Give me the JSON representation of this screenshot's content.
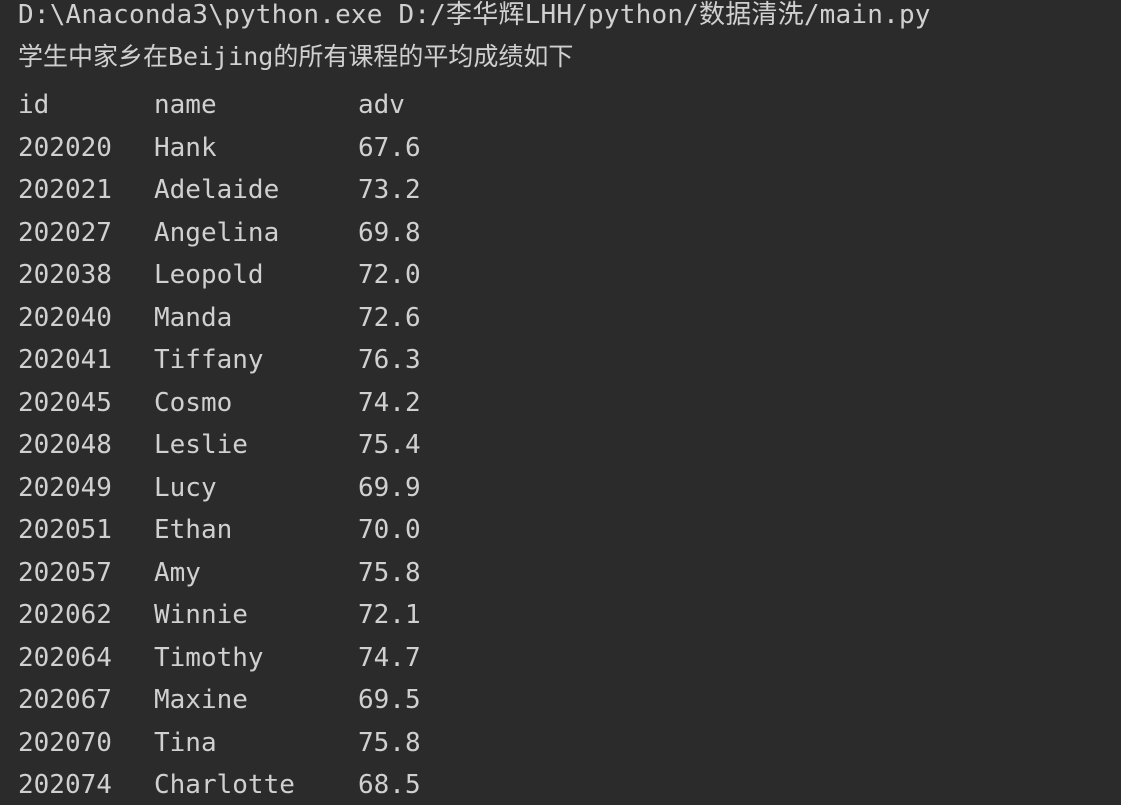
{
  "console": {
    "command": "D:\\Anaconda3\\python.exe D:/李华辉LHH/python/数据清洗/main.py",
    "caption": "学生中家乡在Beijing的所有课程的平均成绩如下",
    "headers": [
      "id",
      "name",
      "adv"
    ],
    "rows": [
      [
        "202020",
        "Hank",
        "67.6"
      ],
      [
        "202021",
        "Adelaide",
        "73.2"
      ],
      [
        "202027",
        "Angelina",
        "69.8"
      ],
      [
        "202038",
        "Leopold",
        "72.0"
      ],
      [
        "202040",
        "Manda",
        "72.6"
      ],
      [
        "202041",
        "Tiffany",
        "76.3"
      ],
      [
        "202045",
        "Cosmo",
        "74.2"
      ],
      [
        "202048",
        "Leslie",
        "75.4"
      ],
      [
        "202049",
        "Lucy",
        "69.9"
      ],
      [
        "202051",
        "Ethan",
        "70.0"
      ],
      [
        "202057",
        "Amy",
        "75.8"
      ],
      [
        "202062",
        "Winnie",
        "72.1"
      ],
      [
        "202064",
        "Timothy",
        "74.7"
      ],
      [
        "202067",
        "Maxine",
        "69.5"
      ],
      [
        "202070",
        "Tina",
        "75.8"
      ],
      [
        "202074",
        "Charlotte",
        "68.5"
      ]
    ]
  },
  "colors": {
    "background": "#2b2b2b",
    "text": "#d0d0d0"
  }
}
